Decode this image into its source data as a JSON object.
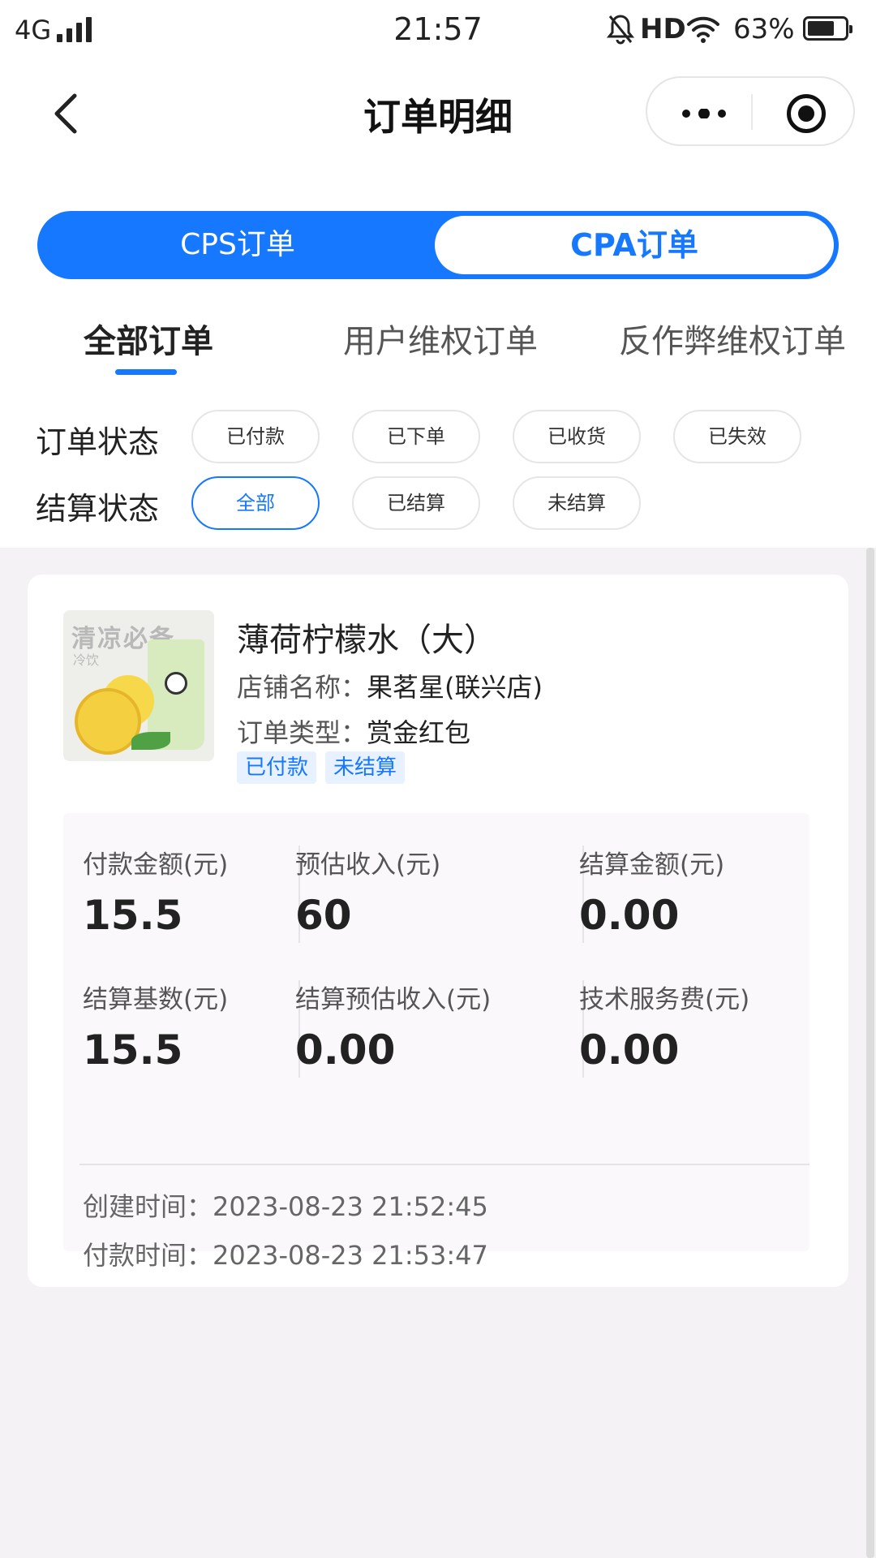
{
  "status_bar": {
    "network": "4G",
    "time": "21:57",
    "hd": "HD",
    "battery": "63%"
  },
  "nav": {
    "title": "订单明细"
  },
  "segment": {
    "left": "CPS订单",
    "right": "CPA订单"
  },
  "tabs": [
    "全部订单",
    "用户维权订单",
    "反作弊维权订单"
  ],
  "filters": {
    "order_status": {
      "label": "订单状态",
      "options": [
        "已付款",
        "已下单",
        "已收货",
        "已失效"
      ]
    },
    "settle_status": {
      "label": "结算状态",
      "options": [
        "全部",
        "已结算",
        "未结算"
      ],
      "selected": "全部"
    }
  },
  "order": {
    "thumb_text": "清凉必备",
    "thumb_sub": "冷饮",
    "name": "薄荷柠檬水（大）",
    "shop_label": "店铺名称：",
    "shop": "果茗星(联兴店)",
    "type_label": "订单类型：",
    "type": "赏金红包",
    "badges": [
      "已付款",
      "未结算"
    ],
    "stats": [
      {
        "label": "付款金额(元)",
        "value": "15.5"
      },
      {
        "label": "预估收入(元)",
        "value": "60"
      },
      {
        "label": "结算金额(元)",
        "value": "0.00"
      },
      {
        "label": "结算基数(元)",
        "value": "15.5"
      },
      {
        "label": "结算预估收入(元)",
        "value": "0.00"
      },
      {
        "label": "技术服务费(元)",
        "value": "0.00"
      }
    ],
    "created": "创建时间：2023-08-23 21:52:45",
    "paid": "付款时间：2023-08-23 21:53:47"
  },
  "colors": {
    "accent": "#1677ff",
    "badge_bg": "#e8f1ff",
    "page_bg": "#f5f2f6"
  }
}
